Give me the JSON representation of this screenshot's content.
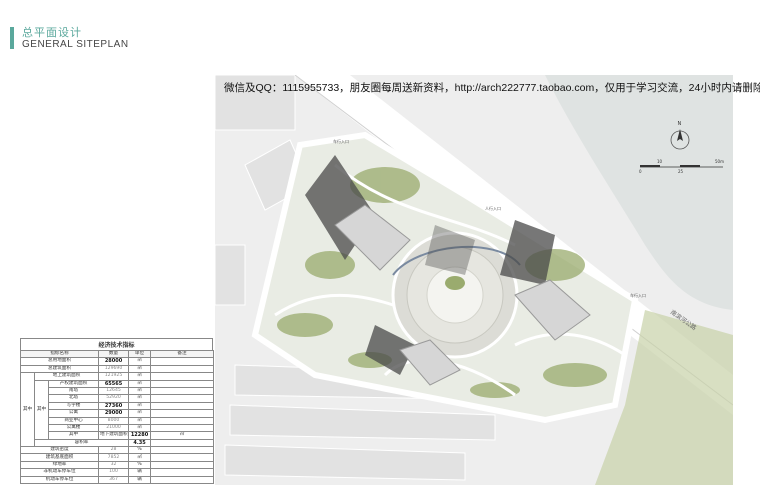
{
  "header": {
    "title_cn": "总平面设计",
    "title_en": "GENERAL SITEPLAN",
    "accent_color": "#5aa89c"
  },
  "watermark": "微信及QQ：1115955733，朋友圈每周送新资料，http://arch222777.taobao.com，仅用于学习交流，24小时内请删除",
  "plan": {
    "road_label": "南滨河公路",
    "north_icon": "north-arrow-icon",
    "north_label": "N",
    "scale_top": [
      "10",
      "50m"
    ],
    "scale_bottom": [
      "0",
      "25"
    ],
    "entrance_labels": [
      "车行入口",
      "人行入口",
      "车行入口"
    ],
    "colors": {
      "water": "#dfe3e2",
      "road": "#ffffff",
      "ground": "#eeeeee",
      "green": "#9aab6e",
      "shadow": "#4a4a4a"
    }
  },
  "econ_table": {
    "title": "经济技术指标",
    "headers": [
      "指标名称",
      "数量",
      "单位",
      "备注"
    ],
    "rows": [
      {
        "c1": "",
        "c2": "",
        "c3": "总用地面积",
        "value": "28000",
        "unit": "㎡",
        "note": ""
      },
      {
        "c1": "",
        "c2": "",
        "c3": "总建筑面积",
        "value": "129690",
        "unit": "㎡",
        "note": ""
      },
      {
        "c1": "",
        "c2": "",
        "c3": "地上建筑面积",
        "value": "121925",
        "unit": "㎡",
        "note": ""
      },
      {
        "c1": "",
        "c2": "",
        "c3": "产权建筑面积",
        "value": "65565",
        "unit": "㎡",
        "note": ""
      },
      {
        "c1": "",
        "c2": "",
        "c3": "南塔",
        "value": "12645",
        "unit": "㎡",
        "note": ""
      },
      {
        "c1": "",
        "c2": "",
        "c3": "北塔",
        "value": "52920",
        "unit": "㎡",
        "note": ""
      },
      {
        "c1": "",
        "c2": "",
        "c3": "写字楼",
        "value": "27360",
        "unit": "㎡",
        "note": ""
      },
      {
        "c1": "",
        "c2": "",
        "c3": "公寓",
        "value": "29000",
        "unit": "㎡",
        "note": ""
      },
      {
        "c1": "",
        "c2": "",
        "c3": "商业中心",
        "value": "8000",
        "unit": "㎡",
        "note": ""
      },
      {
        "c1": "",
        "c2": "",
        "c3": "公寓楼",
        "value": "21000",
        "unit": "㎡",
        "note": ""
      },
      {
        "c1": "",
        "c2": "",
        "c3": "地下建筑面积",
        "value": "12280",
        "unit": "㎡",
        "note": ""
      },
      {
        "c1": "",
        "c2": "",
        "c3": "容积率",
        "value": "4.35",
        "unit": "",
        "note": ""
      },
      {
        "c1": "",
        "c2": "",
        "c3": "建筑密度",
        "value": "28",
        "unit": "%",
        "note": ""
      },
      {
        "c1": "",
        "c2": "",
        "c3": "建筑基底面积",
        "value": "7852",
        "unit": "㎡",
        "note": ""
      },
      {
        "c1": "",
        "c2": "",
        "c3": "绿地率",
        "value": "32",
        "unit": "%",
        "note": ""
      },
      {
        "c1": "",
        "c2": "",
        "c3": "非机动车停车位",
        "value": "100",
        "unit": "辆",
        "note": ""
      },
      {
        "c1": "",
        "c2": "",
        "c3": "机动车停车位",
        "value": "367",
        "unit": "辆",
        "note": ""
      }
    ],
    "group_labels": [
      "其中",
      "其中",
      "其中"
    ]
  }
}
